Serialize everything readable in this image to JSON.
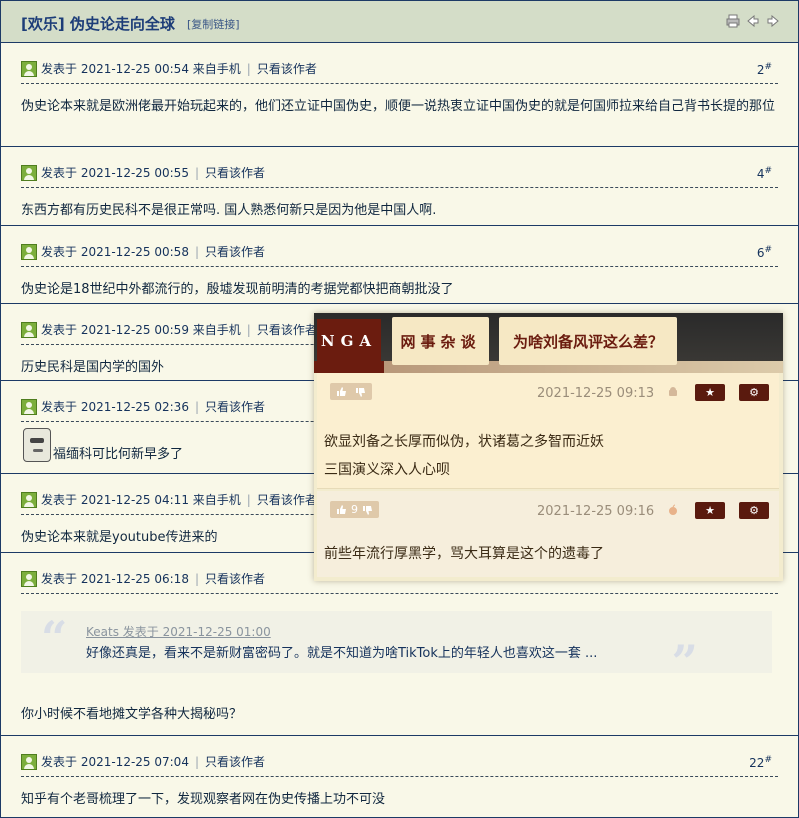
{
  "header": {
    "title": "[欢乐] 伪史论走向全球",
    "copy_link": "[复制链接]"
  },
  "posts": [
    {
      "meta": "发表于 2021-12-25 00:54 来自手机",
      "only_author": "只看该作者",
      "floor": "2",
      "floor_mark": "#",
      "content": "伪史论本来就是欧洲佬最开始玩起来的，他们还立证中国伪史，顺便一说热衷立证中国伪史的就是何国师拉来给自己背书长提的那位"
    },
    {
      "meta": "发表于 2021-12-25 00:55",
      "only_author": "只看该作者",
      "floor": "4",
      "floor_mark": "#",
      "content": "东西方都有历史民科不是很正常吗. 国人熟悉何新只是因为他是中国人啊."
    },
    {
      "meta": "发表于 2021-12-25 00:58",
      "only_author": "只看该作者",
      "floor": "6",
      "floor_mark": "#",
      "content": "伪史论是18世纪中外都流行的，殷墟发现前明清的考据党都快把商朝批没了"
    },
    {
      "meta": "发表于 2021-12-25 00:59 来自手机",
      "only_author": "只看该作者",
      "floor": "",
      "floor_mark": "",
      "content": "历史民科是国内学的国外"
    },
    {
      "meta": "发表于 2021-12-25 02:36",
      "only_author": "只看该作者",
      "floor": "",
      "floor_mark": "",
      "content": "福缅科可比何新早多了"
    },
    {
      "meta": "发表于 2021-12-25 04:11 来自手机",
      "only_author": "只看该作者",
      "floor": "",
      "floor_mark": "",
      "content": "伪史论本来就是youtube传进来的"
    },
    {
      "meta": "发表于 2021-12-25 06:18",
      "only_author": "只看该作者",
      "floor": "",
      "floor_mark": "",
      "quote_author": "Keats 发表于 2021-12-25 01:00",
      "quote_text": "好像还真是，看来不是新财富密码了。就是不知道为啥TikTok上的年轻人也喜欢这一套 ...",
      "content": "你小时候不看地摊文学各种大揭秘吗？"
    },
    {
      "meta": "发表于 2021-12-25 07:04",
      "only_author": "只看该作者",
      "floor": "22",
      "floor_mark": "#",
      "content": "知乎有个老哥梳理了一下，发现观察者网在伪史传播上功不可没"
    }
  ],
  "overlay": {
    "brand": "NGA",
    "forum": "网事杂谈",
    "topic": "为啥刘备风评这么差？",
    "replies": [
      {
        "votes": "",
        "date": "2021-12-25 09:13",
        "device": "android-icon",
        "lines": [
          "欲显刘备之长厚而似伪，状诸葛之多智而近妖",
          "三国演义深入人心呗"
        ]
      },
      {
        "votes": "9",
        "date": "2021-12-25 09:16",
        "device": "apple-icon",
        "lines": [
          "前些年流行厚黑学，骂大耳算是这个的遗毒了"
        ]
      }
    ]
  },
  "colors": {
    "navy": "#1d3a66",
    "header_bg": "#d4ddc8",
    "page_bg": "#f9f8e8",
    "nga_red": "#6b1c0f",
    "overlay_bg": "#fbefd0"
  }
}
